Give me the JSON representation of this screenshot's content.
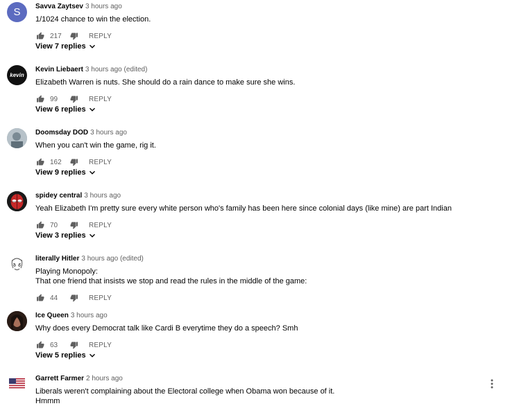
{
  "comments": [
    {
      "author": "Savva Zaytsev",
      "time": "3 hours ago",
      "text": [
        "1/1024 chance to win the election."
      ],
      "likes": "217",
      "reply": "REPLY",
      "view_replies": "View 7 replies",
      "avatar_letter": "S",
      "avatar_color": "#5c6bc0"
    },
    {
      "author": "Kevin Liebaert",
      "time": "3 hours ago (edited)",
      "text": [
        "Elizabeth Warren is nuts. She should do a rain dance to make sure she wins."
      ],
      "likes": "99",
      "reply": "REPLY",
      "view_replies": "View 6 replies",
      "avatar_letter": "kevin",
      "avatar_color": "#111111"
    },
    {
      "author": "Doomsday DOD",
      "time": "3 hours ago",
      "text": [
        "When you can't win the game, rig it."
      ],
      "likes": "162",
      "reply": "REPLY",
      "view_replies": "View 9 replies",
      "avatar_color": "#8a9aa5"
    },
    {
      "author": "spidey central",
      "time": "3 hours ago",
      "text": [
        "Yeah Elizabeth I'm pretty sure every white person who's family has been here since colonial days (like mine) are part Indian"
      ],
      "likes": "70",
      "reply": "REPLY",
      "view_replies": "View 3 replies",
      "avatar_color": "#1a1a1a"
    },
    {
      "author": "literally Hitler",
      "time": "3 hours ago (edited)",
      "text": [
        "Playing Monopoly:",
        "That one friend that insists we stop and read the rules in the middle of the game:"
      ],
      "likes": "44",
      "reply": "REPLY",
      "avatar_color": "#ffffff"
    },
    {
      "author": "Ice Queen",
      "time": "3 hours ago",
      "text": [
        "Why does every Democrat talk like Cardi B everytime they do a speech? Smh"
      ],
      "likes": "63",
      "reply": "REPLY",
      "view_replies": "View 5 replies",
      "avatar_color": "#3a2a22"
    },
    {
      "author": "Garrett Farmer",
      "time": "2 hours ago",
      "text": [
        "Liberals weren't complaining about the Electoral college when Obama won because of it.",
        "Hmmm"
      ],
      "avatar_color": "#b22234"
    }
  ]
}
